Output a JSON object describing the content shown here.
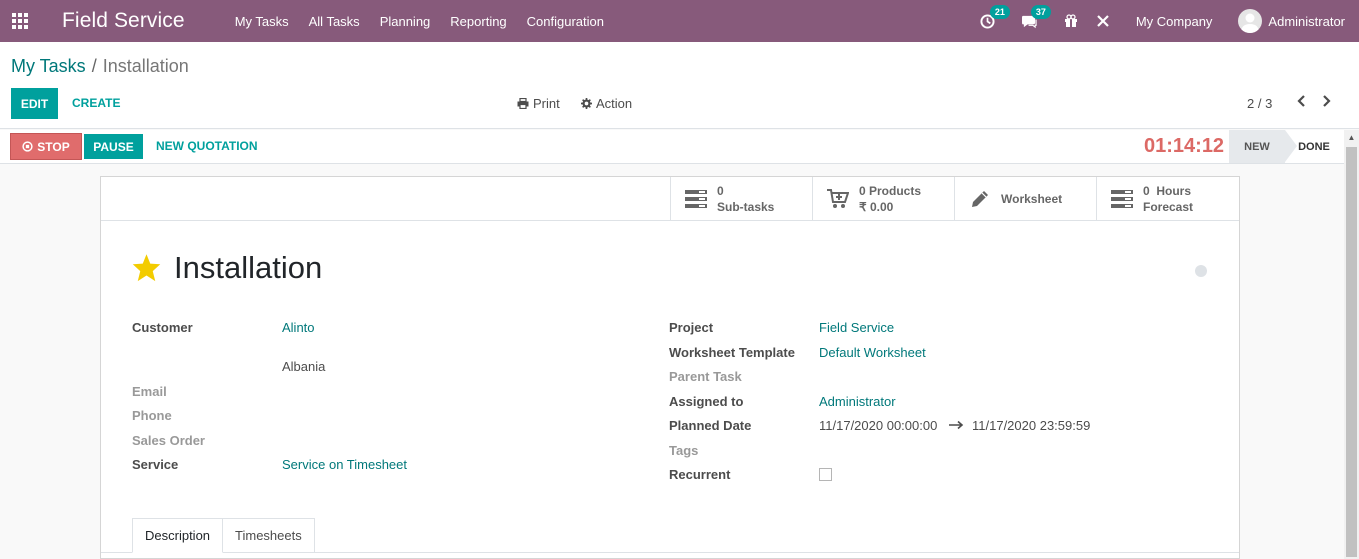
{
  "navbar": {
    "brand": "Field Service",
    "menu": [
      "My Tasks",
      "All Tasks",
      "Planning",
      "Reporting",
      "Configuration"
    ],
    "activity_count": "21",
    "message_count": "37",
    "company": "My Company",
    "user": "Administrator"
  },
  "breadcrumb": {
    "parent": "My Tasks",
    "separator": "/",
    "current": "Installation"
  },
  "control": {
    "edit_label": "EDIT",
    "create_label": "CREATE",
    "print_label": "Print",
    "action_label": "Action",
    "pager": "2 / 3"
  },
  "statusbar": {
    "stop_label": "STOP",
    "pause_label": "PAUSE",
    "quotation_label": "NEW QUOTATION",
    "timer": "01:14:12",
    "stages": [
      "NEW",
      "DONE"
    ],
    "active_stage": "NEW"
  },
  "smart_buttons": {
    "subtasks": {
      "value": "0",
      "label": "Sub-tasks"
    },
    "products": {
      "value": "0 Products",
      "label": "₹ 0.00"
    },
    "worksheet": {
      "label": "Worksheet"
    },
    "hours": {
      "value": "0  Hours",
      "label": "Forecast"
    }
  },
  "task": {
    "title": "Installation",
    "left_fields": {
      "customer_label": "Customer",
      "customer_value": "Alinto",
      "address_value": "Albania",
      "email_label": "Email",
      "phone_label": "Phone",
      "sales_order_label": "Sales Order",
      "service_label": "Service",
      "service_value": "Service on Timesheet"
    },
    "right_fields": {
      "project_label": "Project",
      "project_value": "Field Service",
      "worksheet_template_label": "Worksheet Template",
      "worksheet_template_value": "Default Worksheet",
      "parent_task_label": "Parent Task",
      "assigned_label": "Assigned to",
      "assigned_value": "Administrator",
      "planned_label": "Planned Date",
      "planned_start": "11/17/2020 00:00:00",
      "planned_end": "11/17/2020 23:59:59",
      "tags_label": "Tags",
      "recurrent_label": "Recurrent"
    }
  },
  "tabs": [
    "Description",
    "Timesheets"
  ],
  "colors": {
    "navbar": "#875a7b",
    "primary": "#00a09d",
    "link": "#00787a",
    "stop": "#e06c6c",
    "timer": "#dc6965",
    "star": "#f3cc00"
  }
}
